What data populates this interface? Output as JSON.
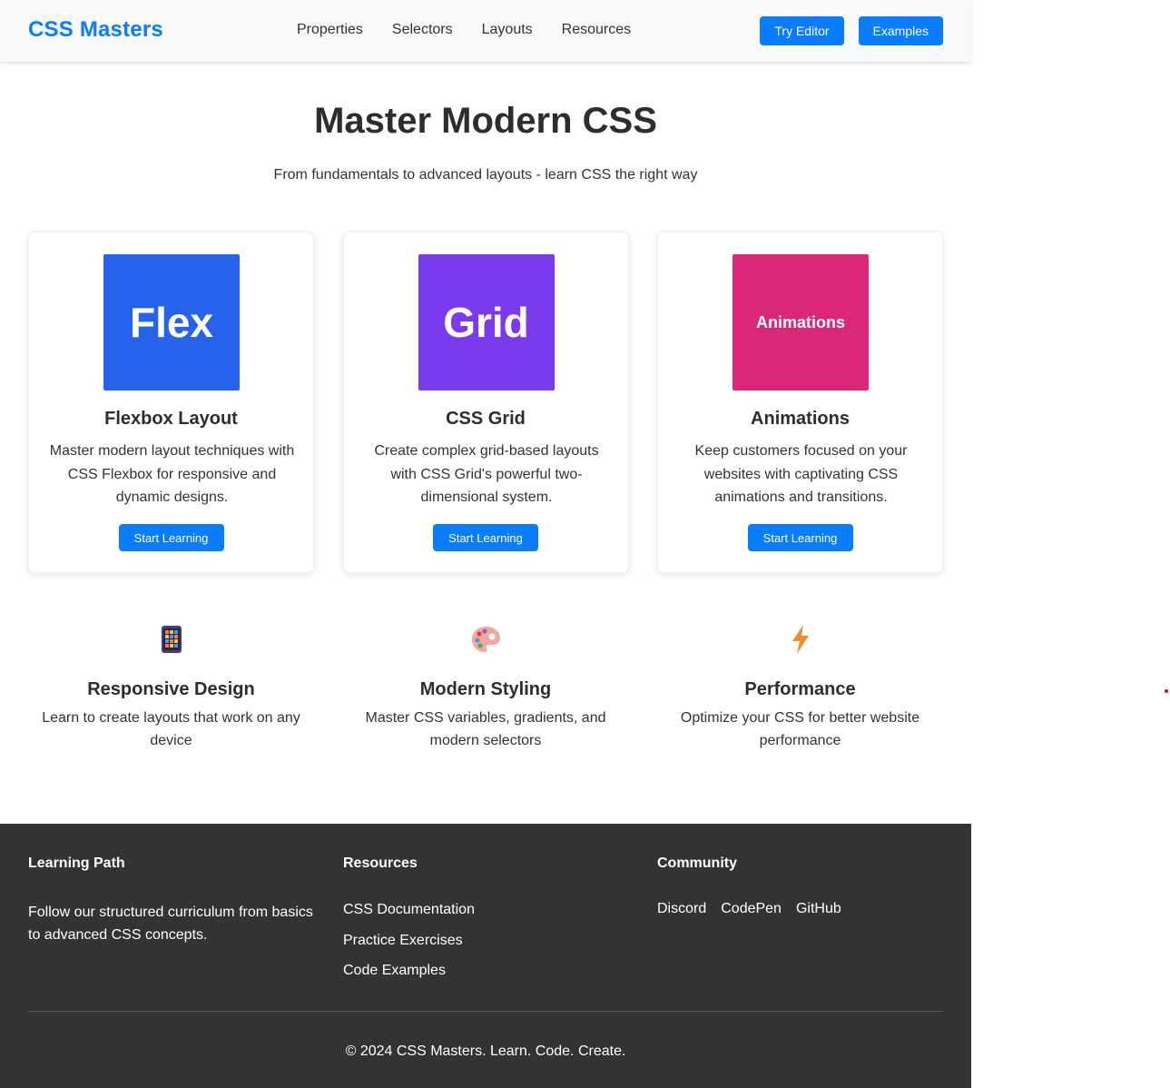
{
  "header": {
    "logo": "CSS Masters",
    "nav": [
      "Properties",
      "Selectors",
      "Layouts",
      "Resources"
    ],
    "buttons": {
      "try_editor": "Try Editor",
      "examples": "Examples"
    }
  },
  "hero": {
    "title": "Master Modern CSS",
    "subtitle": "From fundamentals to advanced layouts - learn CSS the right way"
  },
  "cards": [
    {
      "image_text": "Flex",
      "image_color": "#2563eb",
      "title": "Flexbox Layout",
      "desc": "Master modern layout techniques with CSS Flexbox for responsive and dynamic designs.",
      "button": "Start Learning"
    },
    {
      "image_text": "Grid",
      "image_color": "#7c3aed",
      "title": "CSS Grid",
      "desc": "Create complex grid-based layouts with CSS Grid's powerful two-dimensional system.",
      "button": "Start Learning"
    },
    {
      "image_text": "Animations",
      "image_color": "#db2777",
      "title": "Animations",
      "desc": "Keep customers focused on your websites with captivating CSS animations and transitions.",
      "button": "Start Learning"
    }
  ],
  "features": [
    {
      "icon": "mobile-phone-icon",
      "title": "Responsive Design",
      "desc": "Learn to create layouts that work on any device"
    },
    {
      "icon": "palette-icon",
      "title": "Modern Styling",
      "desc": "Master CSS variables, gradients, and modern selectors"
    },
    {
      "icon": "lightning-icon",
      "title": "Performance",
      "desc": "Optimize your CSS for better website performance"
    }
  ],
  "footer": {
    "learning": {
      "title": "Learning Path",
      "text": "Follow our structured curriculum from basics to advanced CSS concepts."
    },
    "resources": {
      "title": "Resources",
      "links": [
        "CSS Documentation",
        "Practice Exercises",
        "Code Examples"
      ]
    },
    "community": {
      "title": "Community",
      "links": [
        "Discord",
        "CodePen",
        "GitHub"
      ]
    },
    "copyright": "© 2024 CSS Masters. Learn. Code. Create."
  },
  "colors": {
    "accent": "#0a7cff",
    "footer_bg": "#333333"
  }
}
